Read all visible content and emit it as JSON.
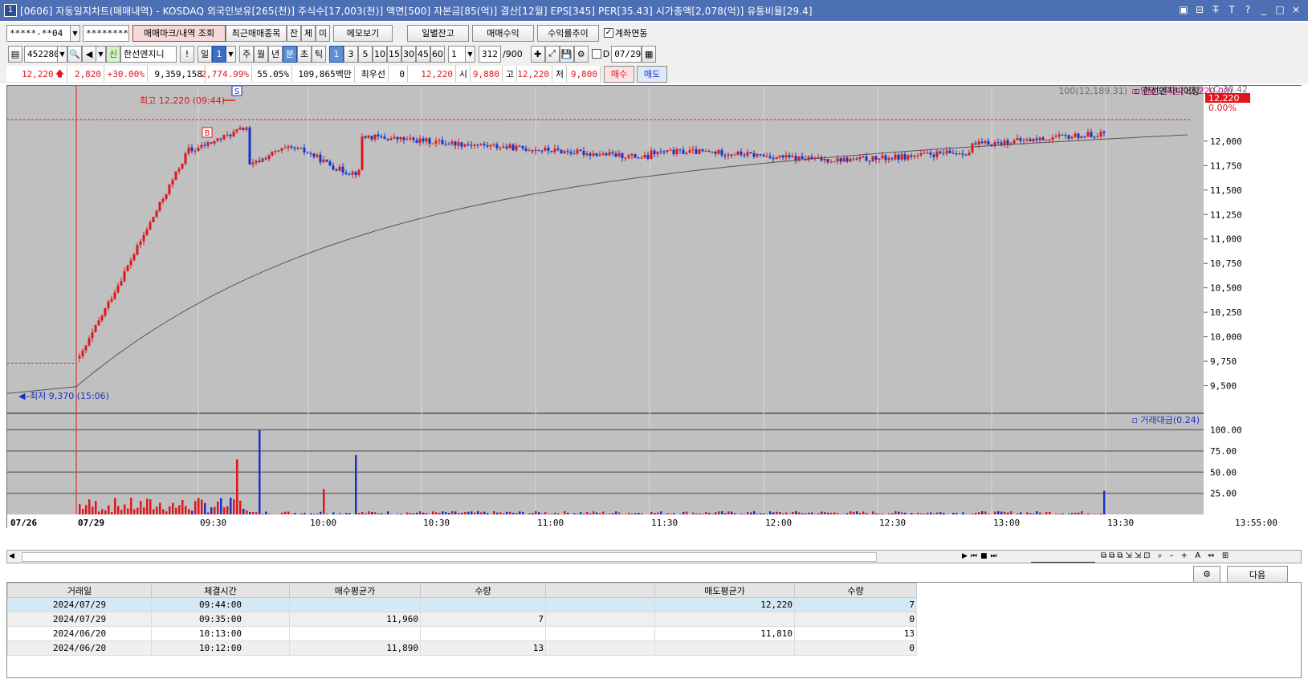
{
  "window": {
    "title": "[0606] 자동일지차트(매매내역) - KOSDAQ 외국인보유[265(천)] 주식수[17,003(천)] 액면[500] 자본금[85(억)] 결산[12월] EPS[345] PER[35.43] 시가총액[2,078(억)] 유통비율[29.4]",
    "icon": "1",
    "controls": [
      "▣",
      "⊟",
      "T̶",
      "T",
      "?",
      "_",
      "□",
      "×"
    ]
  },
  "toolbar1": {
    "account": "*****-**04",
    "password": "********",
    "btn_trade_mark": "매매마크/내역 조회",
    "btn_recent": "최근매매종목",
    "btn_jan": "잔",
    "btn_che": "체",
    "btn_mi": "미",
    "btn_memo": "메모보기",
    "btn_daily_balance": "일별잔고",
    "btn_trade_profit": "매매수익",
    "btn_return_trend": "수익률추이",
    "chk_account_link": "계좌연동"
  },
  "toolbar2": {
    "code": "452280",
    "stock_name": "한선엔지니",
    "credit_icon": "신",
    "period_day": "일",
    "period_num": "1",
    "periods": [
      "주",
      "월",
      "년",
      "분",
      "초",
      "틱"
    ],
    "intervals": [
      "1",
      "3",
      "5",
      "10",
      "15",
      "30",
      "45",
      "60"
    ],
    "interval_select": "1",
    "count": "312",
    "count_max": "/900",
    "date_label": "D",
    "date": "07/29"
  },
  "quote": {
    "price": "12,220",
    "change": "2,820",
    "rate": "+30.00%",
    "volume": "9,359,158",
    "vol_ratio": "2,774.99%",
    "ratio2": "55.05%",
    "amount": "109,865백만",
    "best": "최우선",
    "best_qty": "0",
    "best_price": "12,220",
    "open_label": "시",
    "open": "9,880",
    "high_label": "고",
    "high": "12,220",
    "low_label": "저",
    "low": "9,800",
    "buy": "매수",
    "sell": "매도"
  },
  "chart_data": {
    "type": "candlestick",
    "price_axis": [
      "12,000",
      "11,750",
      "11,500",
      "11,250",
      "11,000",
      "10,750",
      "10,500",
      "10,250",
      "10,000",
      "9,750",
      "9,500"
    ],
    "price_ticks": [
      12000,
      11750,
      11500,
      11250,
      11000,
      10750,
      10500,
      10250,
      10000,
      9750,
      9500
    ],
    "price_range": [
      9250,
      12450
    ],
    "current_price_tag": "12,220",
    "current_rate_tag": "0.00%",
    "lc_label": "LC:30.42",
    "ma_legend": "100(12,189.31)",
    "limit_legend": "당일고가선(12,220.00)",
    "stock_legend": "한선엔지니어링",
    "high_label": "최고 12,220 (09:44)",
    "low_label": "최저 9,370 (15:06)",
    "sell_marker": "S",
    "buy_marker": "B",
    "volume_legend": "거래대금(0.24)",
    "volume_axis": [
      "100.00",
      "75.00",
      "50.00",
      "25.00"
    ],
    "volume_ticks": [
      100,
      75,
      50,
      25
    ],
    "x_labels": [
      "07/26",
      "07/29",
      "09:30",
      "10:00",
      "10:30",
      "11:00",
      "11:30",
      "12:00",
      "12:30",
      "13:00",
      "13:30"
    ],
    "x_end_label": "13:55:00",
    "colors": {
      "up": "#e0161b",
      "down": "#1732c8",
      "ma": "#555555",
      "limit": "#d4148c",
      "bg": "#c0c0c0"
    }
  },
  "trades": {
    "headers": [
      "거래일",
      "체결시간",
      "매수평균가",
      "수량",
      "",
      "매도평균가",
      "수량"
    ],
    "rows": [
      [
        "2024/07/29",
        "09:44:00",
        "",
        "",
        "",
        "12,220",
        "7"
      ],
      [
        "2024/07/29",
        "09:35:00",
        "11,960",
        "7",
        "",
        "",
        "0"
      ],
      [
        "2024/06/20",
        "10:13:00",
        "",
        "",
        "",
        "11,810",
        "13"
      ],
      [
        "2024/06/20",
        "10:12:00",
        "11,890",
        "13",
        "",
        "",
        "0"
      ]
    ],
    "btn_next": "다음"
  }
}
